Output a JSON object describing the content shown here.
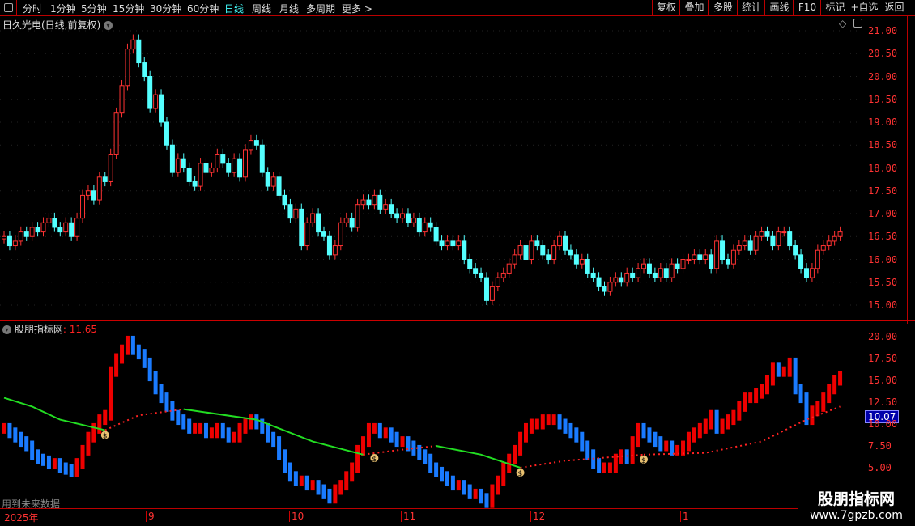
{
  "toolbar": {
    "periods": [
      "分时",
      "1分钟",
      "5分钟",
      "15分钟",
      "30分钟",
      "60分钟",
      "日线",
      "周线",
      "月线",
      "多周期",
      "更多 >"
    ],
    "active_period": "日线",
    "buttons": [
      "复权",
      "叠加",
      "多股",
      "统计",
      "画线",
      "F10",
      "标记",
      "+自选",
      "返回"
    ]
  },
  "main": {
    "title": "日久光电(日线,前复权)",
    "y_ticks": [
      "21.00",
      "20.50",
      "20.00",
      "19.50",
      "19.00",
      "18.50",
      "18.00",
      "17.50",
      "17.00",
      "16.50",
      "16.00",
      "15.50",
      "15.00"
    ],
    "up_color": "#ff3232",
    "down_color": "#54ffff"
  },
  "indicator": {
    "name": "股朋指标网",
    "value": ": 11.65",
    "current_label": "10.07",
    "y_ticks": [
      "20.00",
      "17.50",
      "15.00",
      "12.50",
      "10.00",
      "7.50",
      "5.00"
    ],
    "future_note": "用到未来数据"
  },
  "date_axis": [
    "2025年",
    "9",
    "10",
    "11",
    "12",
    "1"
  ],
  "watermark": {
    "line1": "股朋指标网",
    "line2": "www.7gpzb.com"
  },
  "chart_data": {
    "type": "candlestick",
    "ylim": [
      14.8,
      21.1
    ],
    "close": [
      16.5,
      16.3,
      16.4,
      16.6,
      16.5,
      16.7,
      16.6,
      16.8,
      16.9,
      16.7,
      16.6,
      16.8,
      16.5,
      16.9,
      17.4,
      17.5,
      17.3,
      17.8,
      17.7,
      18.3,
      19.2,
      19.8,
      20.6,
      20.8,
      20.3,
      20.0,
      19.3,
      19.6,
      19.0,
      18.5,
      17.9,
      18.2,
      18.0,
      17.7,
      17.6,
      18.1,
      17.9,
      18.0,
      18.3,
      18.1,
      17.9,
      18.2,
      17.8,
      18.4,
      18.6,
      18.5,
      17.9,
      17.6,
      17.8,
      17.4,
      17.2,
      16.9,
      17.1,
      16.3,
      16.8,
      17.0,
      16.6,
      16.5,
      16.1,
      16.3,
      16.8,
      16.9,
      16.7,
      17.2,
      17.3,
      17.2,
      17.4,
      17.1,
      17.2,
      17.0,
      16.9,
      17.0,
      16.8,
      16.9,
      16.6,
      16.8,
      16.7,
      16.4,
      16.3,
      16.4,
      16.3,
      16.4,
      16.0,
      15.8,
      15.7,
      15.6,
      15.1,
      15.4,
      15.6,
      15.7,
      15.9,
      16.1,
      16.3,
      16.0,
      16.4,
      16.3,
      16.1,
      16.0,
      16.3,
      16.5,
      16.2,
      16.1,
      15.9,
      16.0,
      15.7,
      15.6,
      15.4,
      15.3,
      15.5,
      15.6,
      15.5,
      15.7,
      15.6,
      15.8,
      15.9,
      15.7,
      15.6,
      15.8,
      15.6,
      15.9,
      15.8,
      16.0,
      16.0,
      16.1,
      16.0,
      16.1,
      15.8,
      16.4,
      16.0,
      15.9,
      16.2,
      16.3,
      16.4,
      16.2,
      16.5,
      16.6,
      16.5,
      16.3,
      16.6,
      16.6,
      16.3,
      16.1,
      15.8,
      15.6,
      15.8,
      16.2,
      16.3,
      16.4,
      16.5,
      16.6
    ],
    "indicator_ylim": [
      2,
      21
    ],
    "indicator_bars": [
      9.5,
      9.0,
      8.5,
      8.0,
      7.5,
      6.5,
      6.0,
      5.8,
      5.5,
      5.5,
      5.0,
      4.8,
      4.5,
      5.5,
      7.0,
      8.5,
      9.5,
      10.5,
      11.0,
      16.0,
      17.5,
      18.5,
      19.5,
      18.5,
      18.0,
      17.0,
      15.5,
      14.0,
      13.0,
      12.0,
      11.0,
      10.5,
      10.0,
      9.5,
      9.5,
      9.5,
      9.0,
      9.0,
      9.5,
      9.0,
      8.5,
      8.5,
      9.5,
      10.0,
      10.5,
      10.0,
      9.5,
      8.5,
      8.0,
      6.5,
      5.0,
      4.0,
      3.5,
      3.5,
      3.0,
      3.0,
      2.5,
      2.0,
      1.5,
      2.5,
      3.0,
      4.0,
      5.0,
      7.0,
      8.0,
      9.5,
      9.5,
      9.0,
      9.0,
      8.5,
      8.0,
      8.0,
      7.5,
      7.0,
      6.5,
      6.0,
      5.0,
      4.5,
      4.0,
      3.5,
      3.0,
      3.0,
      2.5,
      2.0,
      2.0,
      1.5,
      1.0,
      2.5,
      3.5,
      5.0,
      6.0,
      7.0,
      8.5,
      9.5,
      10.0,
      10.0,
      10.5,
      10.5,
      10.5,
      10.0,
      9.5,
      9.0,
      8.5,
      7.5,
      6.5,
      5.5,
      5.0,
      5.0,
      5.0,
      6.0,
      6.5,
      6.0,
      8.0,
      9.5,
      9.0,
      8.5,
      8.0,
      7.5,
      7.5,
      7.0,
      7.0,
      7.5,
      8.5,
      9.0,
      9.5,
      10.0,
      11.0,
      9.5,
      10.0,
      10.5,
      11.0,
      12.0,
      13.0,
      13.0,
      13.5,
      14.0,
      15.0,
      16.5,
      16.0,
      16.0,
      17.0,
      14.0,
      13.0,
      10.5,
      11.5,
      12.0,
      13.0,
      14.0,
      15.0,
      15.5
    ],
    "line_segments": [
      {
        "style": "green",
        "points": [
          [
            0,
            13
          ],
          [
            5,
            12
          ],
          [
            10,
            10.5
          ],
          [
            18,
            9.3
          ]
        ]
      },
      {
        "style": "red-dotted",
        "points": [
          [
            18,
            9.3
          ],
          [
            24,
            11
          ],
          [
            32,
            11.7
          ]
        ]
      },
      {
        "style": "green",
        "points": [
          [
            32,
            11.7
          ],
          [
            45,
            10.5
          ],
          [
            55,
            8
          ],
          [
            64,
            6.5
          ]
        ]
      },
      {
        "style": "red-dotted",
        "points": [
          [
            64,
            6.5
          ],
          [
            70,
            7
          ],
          [
            77,
            7.5
          ]
        ]
      },
      {
        "style": "green",
        "points": [
          [
            77,
            7.5
          ],
          [
            85,
            6.5
          ],
          [
            92,
            5
          ]
        ]
      },
      {
        "style": "red-dotted",
        "points": [
          [
            92,
            5
          ],
          [
            100,
            5.8
          ],
          [
            114,
            6.5
          ]
        ]
      },
      {
        "style": "red-dotted",
        "points": [
          [
            114,
            6.5
          ],
          [
            125,
            6.7
          ],
          [
            135,
            8
          ],
          [
            143,
            10.5
          ],
          [
            149,
            12
          ]
        ]
      }
    ],
    "signal_markers": [
      18,
      66,
      92,
      114
    ]
  }
}
